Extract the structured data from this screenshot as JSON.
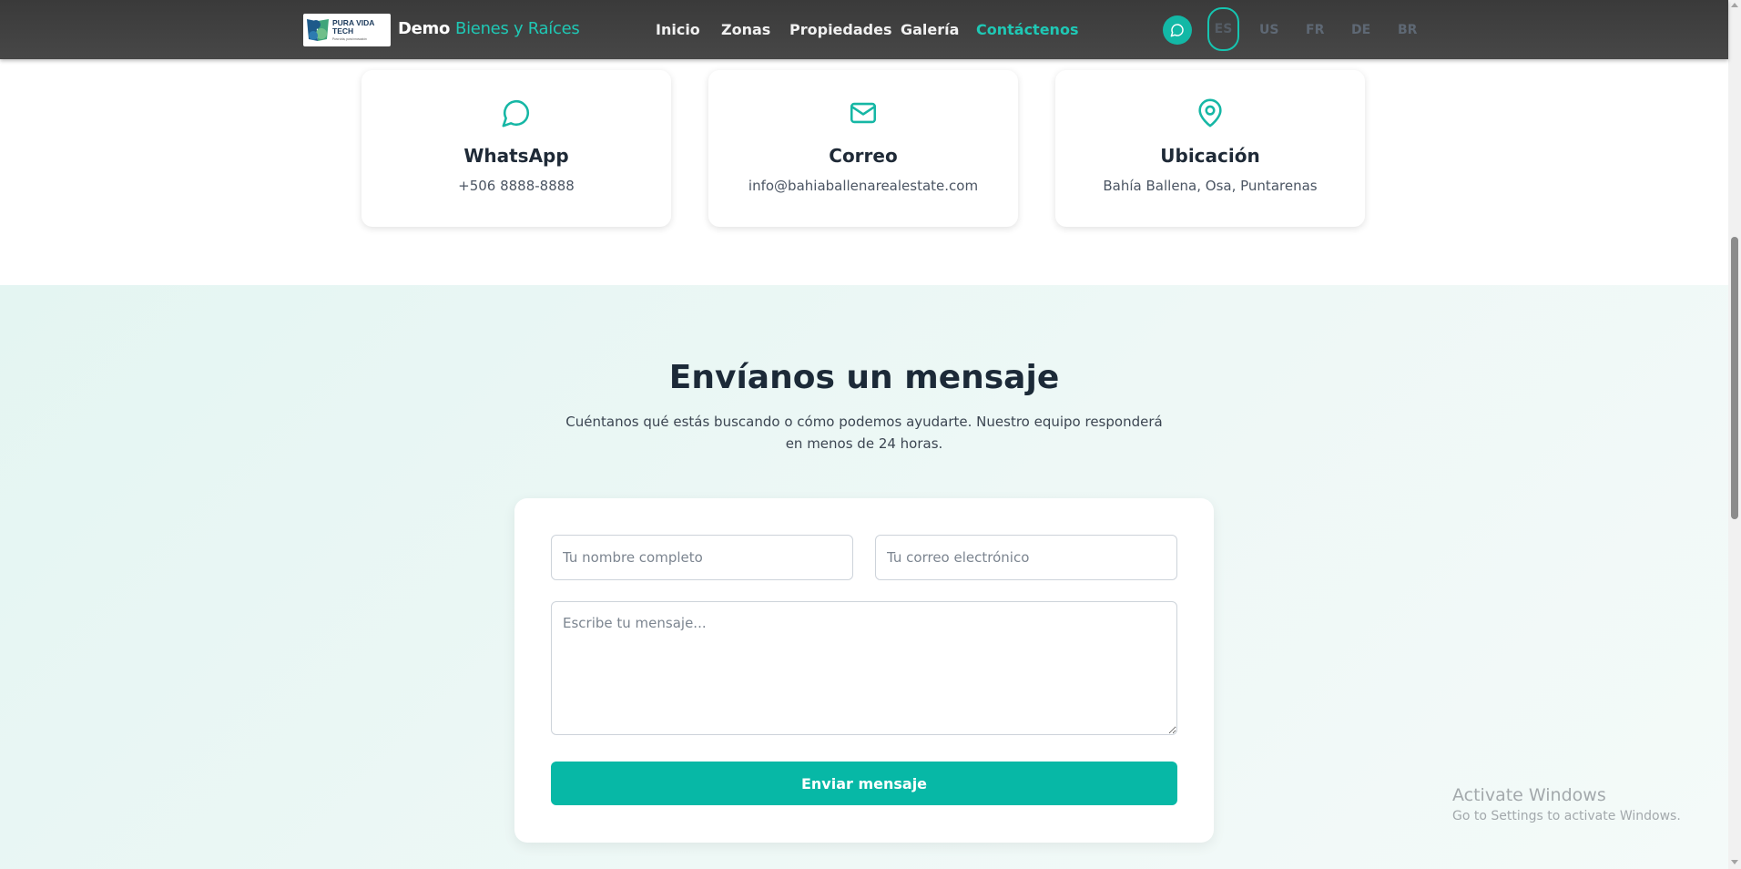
{
  "header": {
    "logo_text_line1": "PURA VIDA",
    "logo_text_line2": "TECH",
    "logo_tagline": "Pura vida, pura innovación",
    "brand_prefix": "Demo",
    "brand_accent": "Bienes y Raíces",
    "nav": [
      {
        "label": "Inicio",
        "active": false
      },
      {
        "label": "Zonas",
        "active": false
      },
      {
        "label": "Propiedades",
        "active": false
      },
      {
        "label": "Galería",
        "active": false
      },
      {
        "label": "Contáctenos",
        "active": true
      }
    ],
    "whatsapp_icon": "chat-bubble-icon",
    "languages": [
      "ES",
      "US",
      "FR",
      "DE",
      "BR"
    ],
    "active_language": "ES"
  },
  "contact_cards": [
    {
      "icon": "chat-bubble-icon",
      "title": "WhatsApp",
      "value": "+506 8888-8888"
    },
    {
      "icon": "mail-icon",
      "title": "Correo",
      "value": "info@bahiaballenarealestate.com"
    },
    {
      "icon": "map-pin-icon",
      "title": "Ubicación",
      "value": "Bahía Ballena, Osa, Puntarenas"
    }
  ],
  "message_section": {
    "title": "Envíanos un mensaje",
    "subtitle": "Cuéntanos qué estás buscando o cómo podemos ayudarte. Nuestro equipo responderá en menos de 24 horas.",
    "name_placeholder": "Tu nombre completo",
    "email_placeholder": "Tu correo electrónico",
    "message_placeholder": "Escribe tu mensaje...",
    "send_label": "Enviar mensaje"
  },
  "watermark": {
    "line1": "Activate Windows",
    "line2": "Go to Settings to activate Windows."
  },
  "colors": {
    "accent": "#1fc8b5",
    "button": "#07b8a6",
    "header_bg": "#3f3f3f",
    "section_bg": "#e8f6f3"
  }
}
